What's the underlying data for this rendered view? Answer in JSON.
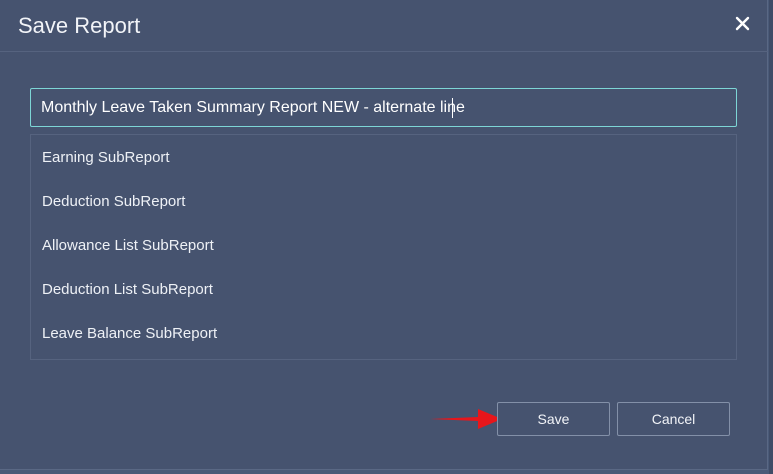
{
  "dialog": {
    "title": "Save Report",
    "close_icon": "close-icon"
  },
  "report_name": {
    "value": "Monthly Leave Taken Summary Report NEW - alternate line"
  },
  "subreports": [
    {
      "label": "Earning SubReport"
    },
    {
      "label": "Deduction SubReport"
    },
    {
      "label": "Allowance List SubReport"
    },
    {
      "label": "Deduction List SubReport"
    },
    {
      "label": "Leave Balance SubReport"
    }
  ],
  "buttons": {
    "save_label": "Save",
    "cancel_label": "Cancel"
  },
  "colors": {
    "background": "#46536f",
    "input_border": "#7dd6d6",
    "arrow": "#e8161b"
  }
}
